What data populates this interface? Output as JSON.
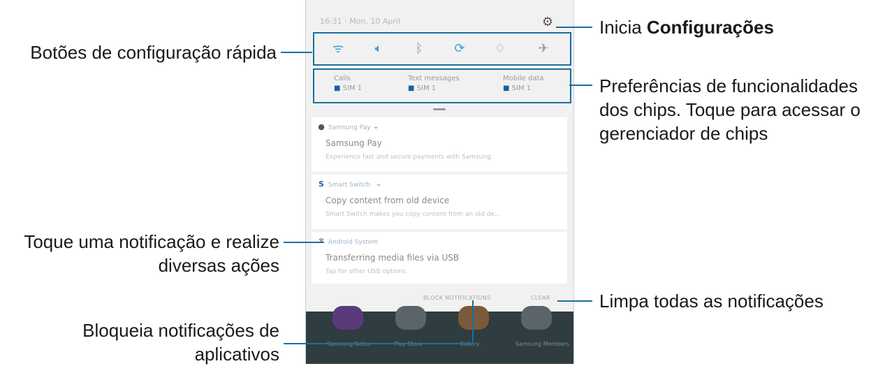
{
  "phone": {
    "status_text": "16:31  ·  Mon, 10 April",
    "quick_settings": [
      {
        "icon": "wifi-icon",
        "glyph": "ᯤ",
        "color": "#3aa3d8"
      },
      {
        "icon": "sound-icon",
        "glyph": "🔈︎",
        "color": "#3aa3d8"
      },
      {
        "icon": "bluetooth-icon",
        "glyph": "ᛒ",
        "color": "#9a9a9a"
      },
      {
        "icon": "auto-rotate-icon",
        "glyph": "⟳",
        "color": "#3aa3d8"
      },
      {
        "icon": "flashlight-icon",
        "glyph": "♢",
        "color": "#9a9a9a"
      },
      {
        "icon": "airplane-icon",
        "glyph": "✈",
        "color": "#9a9a9a"
      }
    ],
    "sim_chips": [
      {
        "title": "Calls",
        "sim": "SIM 1"
      },
      {
        "title": "Text messages",
        "sim": "SIM 1"
      },
      {
        "title": "Mobile data",
        "sim": "SIM 1"
      }
    ],
    "notifications": [
      {
        "app": "Samsung Pay",
        "title": "Samsung Pay",
        "text": "Experience fast and secure payments with Samsung."
      },
      {
        "app": "Smart Switch",
        "title": "Copy content from old device",
        "text": "Smart Switch makes you copy content from an old de..."
      },
      {
        "app": "Android System",
        "title": "Transferring media files via USB",
        "text": "Tap for other USB options."
      }
    ],
    "block_label": "BLOCK NOTIFICATIONS",
    "clear_label": "CLEAR",
    "home_apps": [
      "Samsung Notes",
      "Play Store",
      "Gallery",
      "Samsung Members"
    ]
  },
  "callouts": {
    "quick_buttons": "Botões de configuração rápida",
    "settings_prefix": "Inicia ",
    "settings_bold": "Configurações",
    "sim_line1": "Preferências de funcionalidades",
    "sim_line2": "dos chips. Toque para acessar o",
    "sim_line3": "gerenciador de chips",
    "notif_line1": "Toque uma notificação e realize",
    "notif_line2": "diversas ações",
    "clear": "Limpa todas as notificações",
    "block_line1": "Bloqueia notificações de",
    "block_line2": "aplicativos"
  },
  "colors": {
    "accent": "#1b6fa0"
  }
}
